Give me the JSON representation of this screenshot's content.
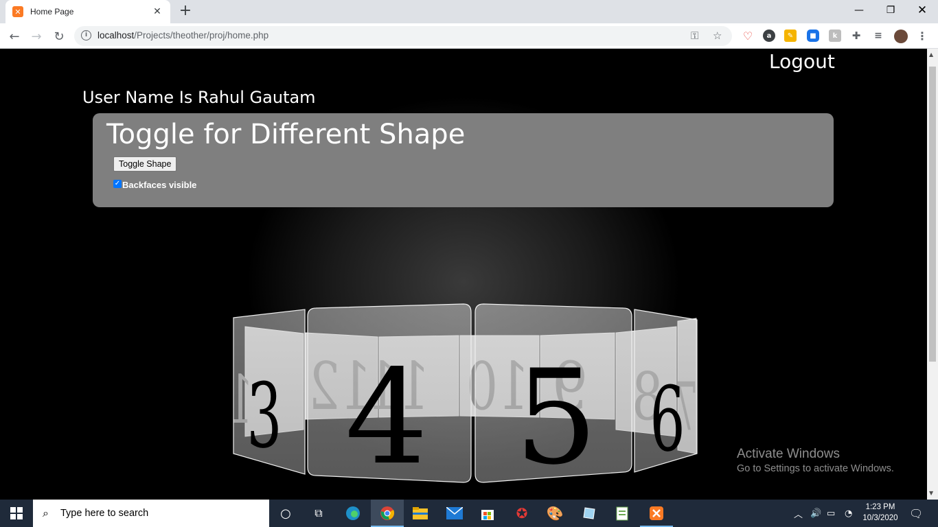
{
  "browser": {
    "tab_title": "Home Page",
    "url_host": "localhost",
    "url_path": "/Projects/theother/proj/home.php"
  },
  "page": {
    "logout_label": "Logout",
    "username_text": "User Name Is Rahul Gautam",
    "panel_title": "Toggle for Different Shape",
    "toggle_button_label": "Toggle Shape",
    "checkbox_label": "Backfaces visible",
    "checkbox_checked": true
  },
  "carousel": {
    "front_numbers": [
      "3",
      "4",
      "5",
      "6"
    ],
    "back_numbers": [
      "1",
      "12",
      "11",
      "10",
      "9",
      "8",
      "7"
    ]
  },
  "watermark": {
    "title": "Activate Windows",
    "subtitle": "Go to Settings to activate Windows."
  },
  "taskbar": {
    "search_placeholder": "Type here to search",
    "time": "1:23 PM",
    "date": "10/3/2020"
  }
}
